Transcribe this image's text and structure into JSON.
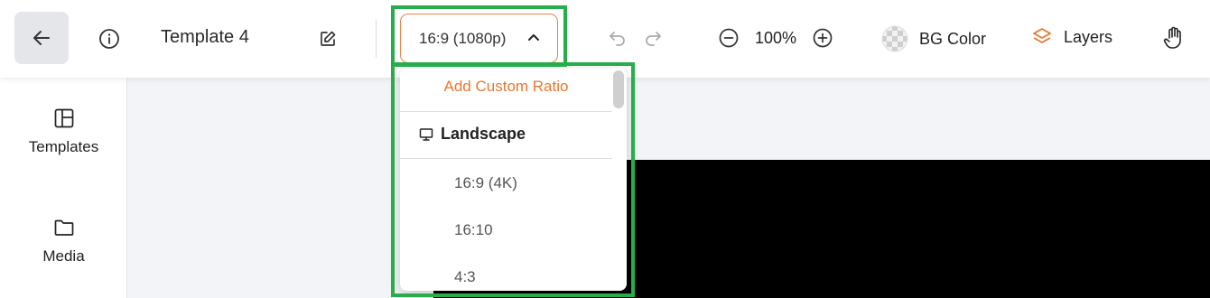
{
  "header": {
    "title": "Template 4",
    "ratio_selected": "16:9 (1080p)",
    "zoom": "100%",
    "bg_color_label": "BG Color",
    "layers_label": "Layers"
  },
  "sidebar": {
    "items": [
      {
        "label": "Templates",
        "icon": "templates-layout-icon"
      },
      {
        "label": "Media",
        "icon": "folder-icon"
      }
    ]
  },
  "ratio_dropdown": {
    "add_custom": "Add Custom Ratio",
    "group_label": "Landscape",
    "group_icon": "monitor-icon",
    "options": [
      "16:9 (4K)",
      "16:10",
      "4:3"
    ]
  },
  "colors": {
    "accent": "#e8772f",
    "highlight": "#27ae4b",
    "canvas": "#000000"
  }
}
